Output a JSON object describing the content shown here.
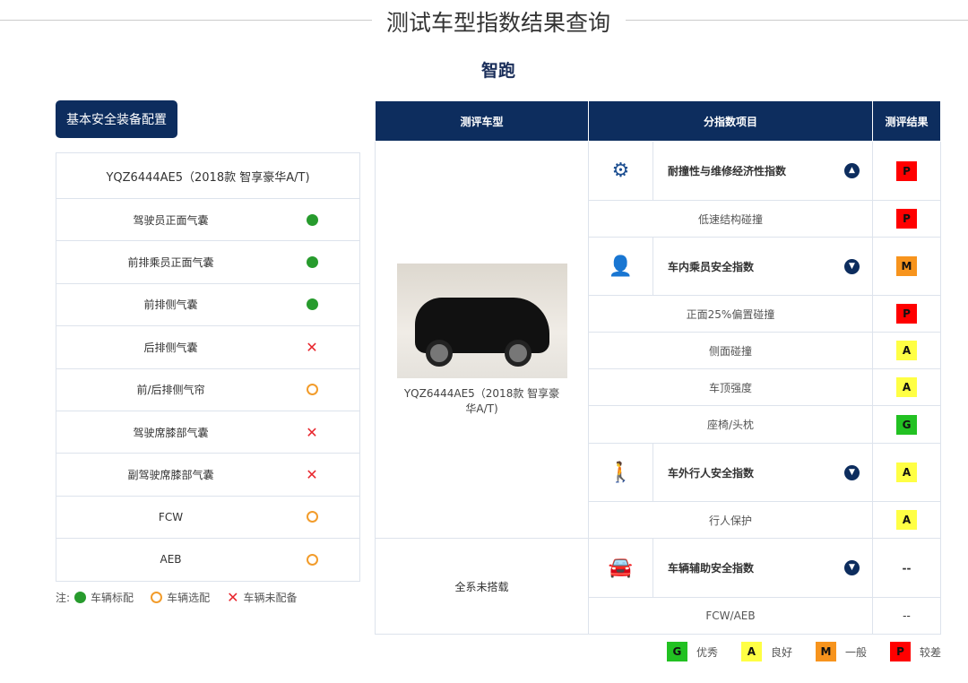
{
  "page_title": "测试车型指数结果查询",
  "model_name": "智跑",
  "equipment": {
    "button": "基本安全装备配置",
    "vehicle": "YQZ6444AE5（2018款 智享豪华A/T)",
    "items": [
      {
        "label": "驾驶员正面气囊",
        "status": "standard"
      },
      {
        "label": "前排乘员正面气囊",
        "status": "standard"
      },
      {
        "label": "前排侧气囊",
        "status": "standard"
      },
      {
        "label": "后排侧气囊",
        "status": "none"
      },
      {
        "label": "前/后排侧气帘",
        "status": "optional"
      },
      {
        "label": "驾驶席膝部气囊",
        "status": "none"
      },
      {
        "label": "副驾驶席膝部气囊",
        "status": "none"
      },
      {
        "label": "FCW",
        "status": "optional"
      },
      {
        "label": "AEB",
        "status": "optional"
      }
    ],
    "note": {
      "prefix": "注:",
      "standard": "车辆标配",
      "optional": "车辆选配",
      "none": "车辆未配备"
    }
  },
  "results": {
    "headers": [
      "测评车型",
      "分指数项目",
      "测评结果"
    ],
    "vehicle_caption": "YQZ6444AE5（2018款 智享豪华A/T)",
    "not_equipped": "全系未搭载",
    "rows": [
      {
        "label": "耐撞性与维修经济性指数",
        "result": "P"
      },
      {
        "label": "低速结构碰撞",
        "result": "P"
      },
      {
        "label": "车内乘员安全指数",
        "result": "M"
      },
      {
        "label": "正面25%偏置碰撞",
        "result": "P"
      },
      {
        "label": "侧面碰撞",
        "result": "A"
      },
      {
        "label": "车顶强度",
        "result": "A"
      },
      {
        "label": "座椅/头枕",
        "result": "G"
      },
      {
        "label": "车外行人安全指数",
        "result": "A"
      },
      {
        "label": "行人保护",
        "result": "A"
      },
      {
        "label": "车辆辅助安全指数",
        "result": "--"
      },
      {
        "label": "FCW/AEB",
        "result": "--"
      }
    ]
  },
  "legend": [
    {
      "code": "G",
      "label": "优秀",
      "color": "#22c122"
    },
    {
      "code": "A",
      "label": "良好",
      "color": "#ffff44"
    },
    {
      "code": "M",
      "label": "一般",
      "color": "#f7941d"
    },
    {
      "code": "P",
      "label": "较差",
      "color": "#ff0000"
    }
  ]
}
